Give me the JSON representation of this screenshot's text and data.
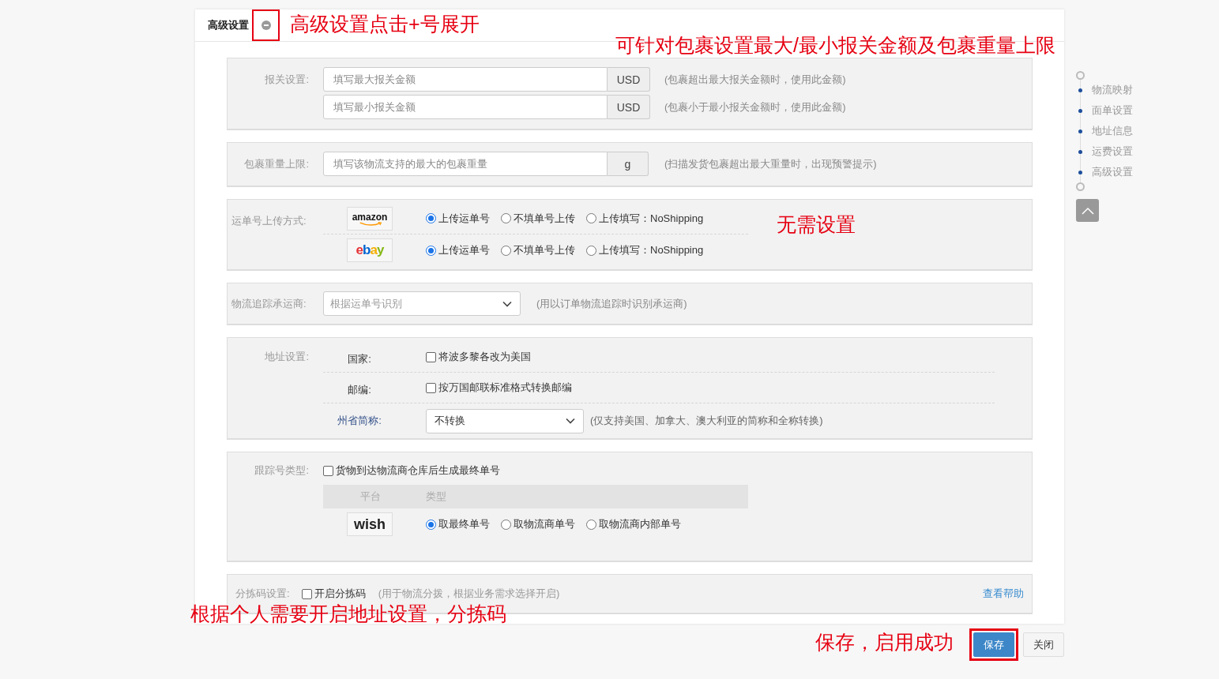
{
  "header": {
    "title": "高级设置",
    "expanded": true,
    "highlighted": true
  },
  "sections": [
    {
      "kind": "inputs",
      "label": "报关设置:",
      "rows": [
        {
          "placeholder": "填写最大报关金额",
          "unit": "USD",
          "hint": "(包裹超出最大报关金额时，使用此金额)"
        },
        {
          "placeholder": "填写最小报关金额",
          "unit": "USD",
          "hint": "(包裹小于最小报关金额时，使用此金额)"
        }
      ]
    },
    {
      "kind": "inputs",
      "label": "包裹重量上限:",
      "rows": [
        {
          "placeholder": "填写该物流支持的最大的包裹重量",
          "unit": "g",
          "hint": "(扫描发货包裹超出最大重量时，出现预警提示)"
        }
      ]
    },
    {
      "kind": "platforms",
      "label": "运单号上传方式:",
      "rows": [
        {
          "kind": "amazon",
          "logo": "amazon",
          "options": [
            {
              "label": "上传运单号",
              "selected": true
            },
            {
              "label": "不填单号上传",
              "selected": false
            },
            {
              "label": "上传填写：NoShipping",
              "selected": false
            }
          ]
        },
        {
          "kind": "ebay",
          "logo": "ebay",
          "options": [
            {
              "label": "上传运单号",
              "selected": true
            },
            {
              "label": "不填单号上传",
              "selected": false
            },
            {
              "label": "上传填写：NoShipping",
              "selected": false
            }
          ]
        }
      ]
    },
    {
      "kind": "select",
      "label": "物流追踪承运商:",
      "value": "根据运单号识别",
      "hint": "(用以订单物流追踪时识别承运商)"
    },
    {
      "kind": "address",
      "label": "地址设置:",
      "rows": [
        {
          "kind": "checkbox",
          "label": "国家:",
          "text": "将波多黎各改为美国",
          "checked": false
        },
        {
          "kind": "checkbox",
          "label": "邮编:",
          "text": "按万国邮联标准格式转换邮编",
          "checked": false
        },
        {
          "kind": "select",
          "label": "州省简称:",
          "value": "不转换",
          "hint": "(仅支持美国、加拿大、澳大利亚的简称和全称转换)"
        }
      ]
    },
    {
      "kind": "tracking",
      "label": "跟踪号类型:",
      "checkbox": {
        "text": "货物到达物流商仓库后生成最终单号",
        "checked": false
      },
      "columns": [
        "平台",
        "类型"
      ],
      "rows": [
        {
          "kind": "wish",
          "logo": "wish",
          "options": [
            {
              "label": "取最终单号",
              "selected": true
            },
            {
              "label": "取物流商单号",
              "selected": false
            },
            {
              "label": "取物流商内部单号",
              "selected": false
            }
          ]
        }
      ]
    },
    {
      "kind": "sorting",
      "label": "分拣码设置:",
      "checkbox": {
        "text": "开启分拣码",
        "checked": false
      },
      "hint": "(用于物流分拨，根据业务需求选择开启)",
      "link": "查看帮助"
    }
  ],
  "nav": {
    "items": [
      "物流映射",
      "面单设置",
      "地址信息",
      "运费设置",
      "高级设置"
    ]
  },
  "buttons": [
    {
      "label": "保存",
      "kind": "primary",
      "highlighted": true
    },
    {
      "label": "关闭",
      "kind": "default"
    }
  ],
  "annotations": [
    "高级设置点击+号展开",
    "可针对包裹设置最大/最小报关金额及包裹重量上限",
    "无需设置",
    "根据个人需要开启地址设置，分拣码",
    "保存，启用成功"
  ]
}
